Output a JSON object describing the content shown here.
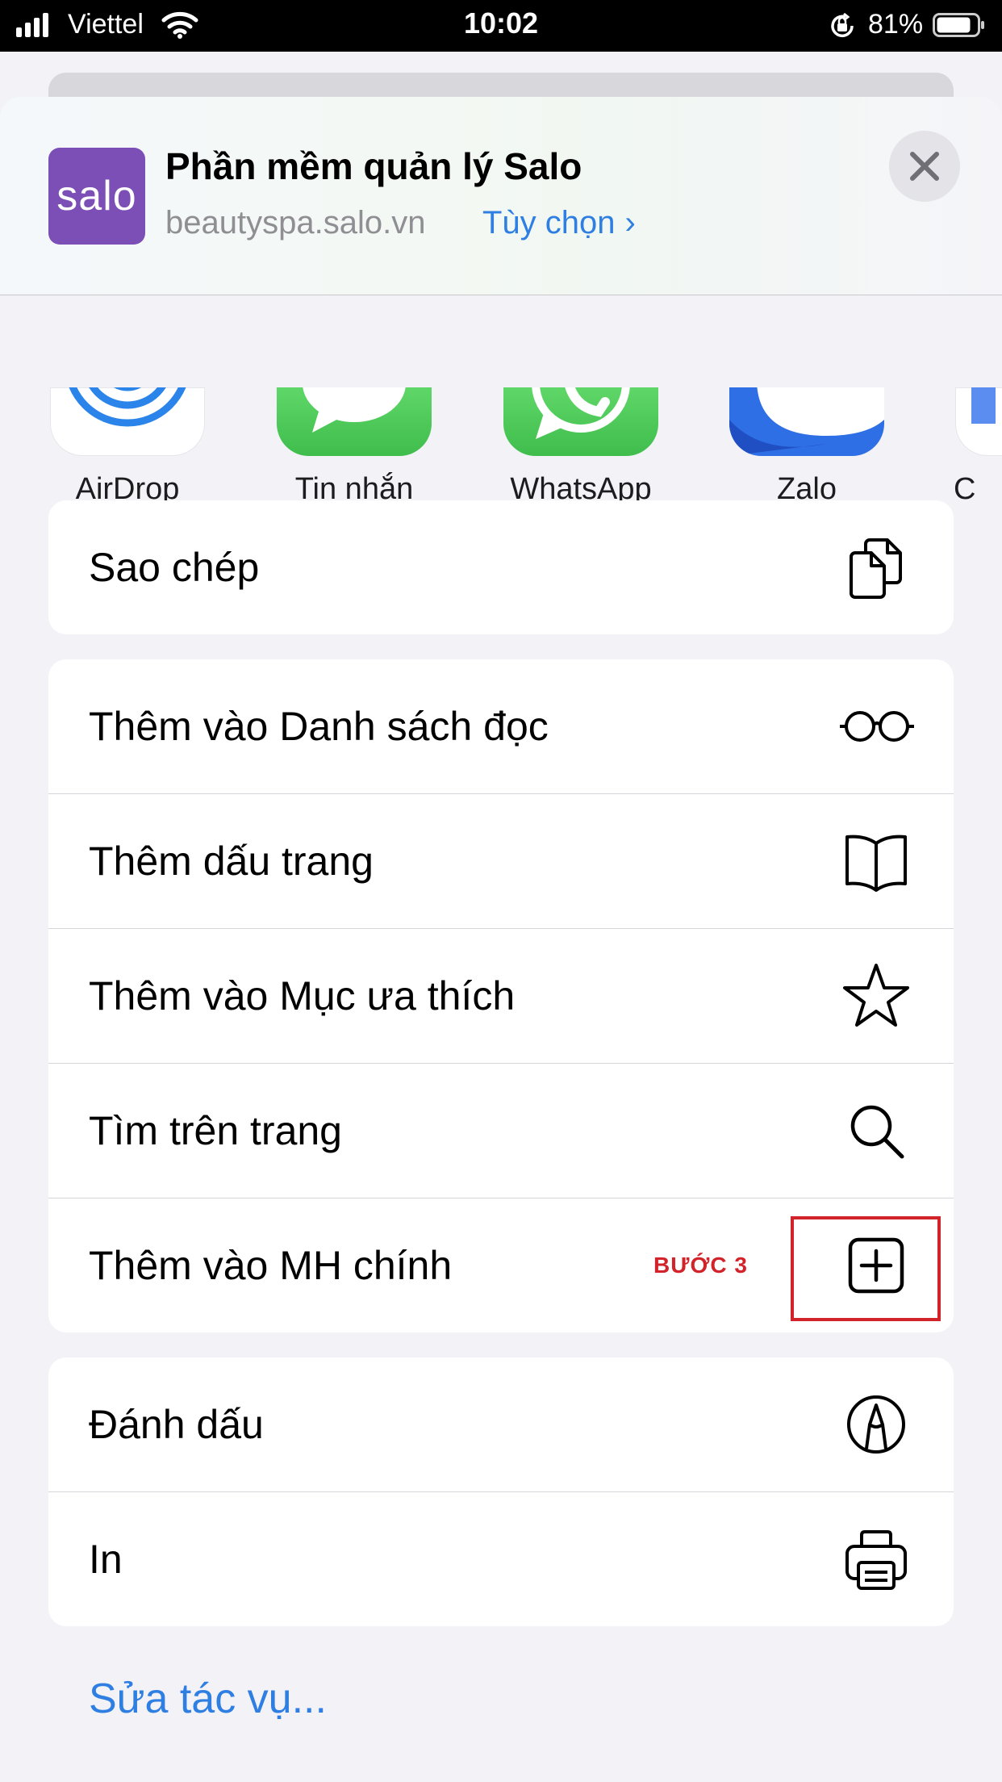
{
  "status_bar": {
    "carrier": "Viettel",
    "time": "10:02",
    "battery_percent": "81%",
    "icons": [
      "signal-icon",
      "wifi-icon",
      "orientation-lock-icon",
      "battery-icon"
    ]
  },
  "share_header": {
    "site_title": "Phần mềm quản lý Salo",
    "site_url": "beautyspa.salo.vn",
    "site_icon_text": "salo",
    "options_label": "Tùy chọn",
    "options_chevron": "›",
    "colors": {
      "site_icon_bg": "#7b4fb5",
      "link": "#2f7fe3"
    }
  },
  "apps": [
    {
      "label": "AirDrop",
      "icon": "airdrop-icon"
    },
    {
      "label": "Tin nhắn",
      "icon": "messages-icon"
    },
    {
      "label": "WhatsApp",
      "icon": "whatsapp-icon"
    },
    {
      "label": "Zalo",
      "icon": "zalo-icon"
    },
    {
      "label": "C",
      "icon": "app-icon"
    }
  ],
  "groups": [
    [
      {
        "label": "Sao chép",
        "icon": "copy-icon"
      }
    ],
    [
      {
        "label": "Thêm vào Danh sách đọc",
        "icon": "glasses-icon"
      },
      {
        "label": "Thêm dấu trang",
        "icon": "book-icon"
      },
      {
        "label": "Thêm vào Mục ưa thích",
        "icon": "star-icon"
      },
      {
        "label": "Tìm trên trang",
        "icon": "search-icon"
      },
      {
        "label": "Thêm vào MH chính",
        "icon": "add-square-icon",
        "annotation": "BƯỚC 3",
        "highlight_color": "#d2232a"
      }
    ],
    [
      {
        "label": "Đánh dấu",
        "icon": "markup-icon"
      },
      {
        "label": "In",
        "icon": "printer-icon"
      }
    ]
  ],
  "edit_actions_label": "Sửa tác vụ..."
}
